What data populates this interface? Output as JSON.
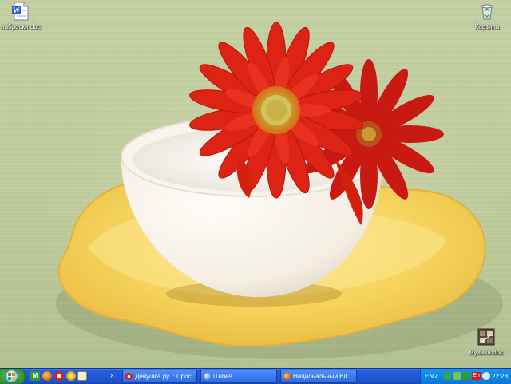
{
  "desktop": {
    "icons": [
      {
        "label": "наброски.doc",
        "icon": "word-document-icon"
      },
      {
        "label": "Корзина",
        "icon": "recycle-bin-icon"
      },
      {
        "label": "музыка.doc",
        "icon": "music-document-icon"
      }
    ],
    "wallpaper": {
      "subject": "red-gerbera-in-white-cup-on-yellow-saucer",
      "colors": {
        "background": "#c5d1a3",
        "flower": "#d81c10",
        "saucer": "#f6d45e",
        "cup": "#f6f1e6"
      }
    }
  },
  "taskbar": {
    "start": {
      "icon": "windows-flag-icon"
    },
    "quick_launch": [
      "mail-icon",
      "firefox-icon",
      "opera-icon",
      "qip-icon",
      "notepad-icon"
    ],
    "overflow": "›",
    "tasks": [
      {
        "label": "Девушка.ру :: Прос...",
        "icon": "opera-icon"
      },
      {
        "label": "iTunes",
        "icon": "itunes-icon"
      },
      {
        "label": "Национальный Bit...",
        "icon": "firefox-icon"
      }
    ],
    "tray": {
      "language": "EN",
      "expand": "‹",
      "badge": "En",
      "clock": "22:28"
    }
  }
}
